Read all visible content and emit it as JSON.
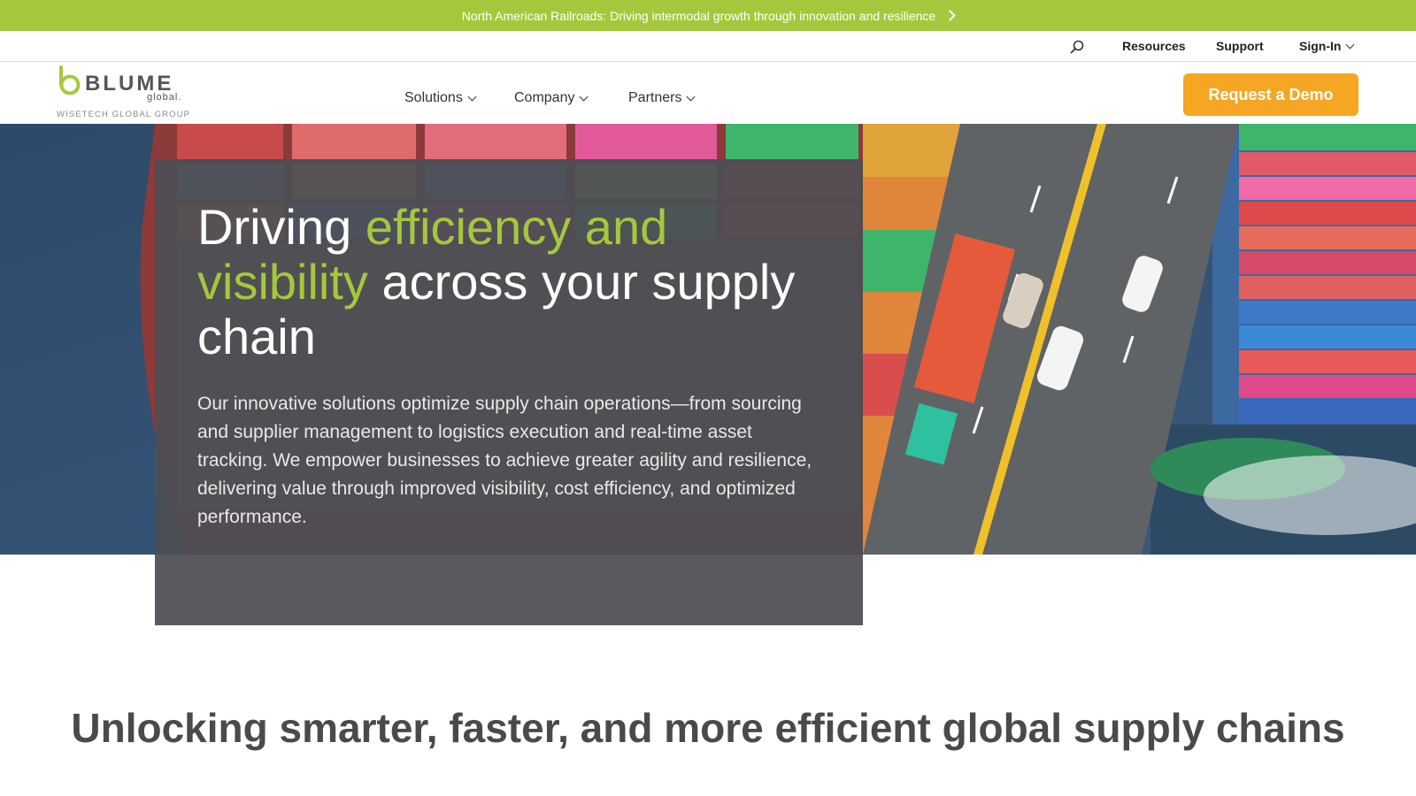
{
  "announcement": {
    "text": "North American Railroads: Driving intermodal growth through innovation and resilience"
  },
  "utility_nav": {
    "search_icon": "search-icon",
    "resources": "Resources",
    "support": "Support",
    "signin": "Sign-In"
  },
  "brand": {
    "name": "BLUME",
    "suffix": "global.",
    "tagline": "WISETECH GLOBAL GROUP"
  },
  "main_nav": {
    "items": [
      "Solutions",
      "Company",
      "Partners"
    ],
    "cta": "Request a Demo"
  },
  "hero": {
    "title_part1": "Driving ",
    "title_accent": "efficiency and visibility",
    "title_part2": " across your supply chain",
    "body": "Our innovative solutions optimize supply chain operations—from sourcing and supplier management to logistics execution and real-time asset tracking. We empower businesses to achieve greater agility and resilience, delivering value through improved visibility, cost efficiency, and optimized performance."
  },
  "section": {
    "title": "Unlocking smarter, faster, and more efficient global supply chains"
  },
  "colors": {
    "brand_green": "#a4c83c",
    "cta_orange": "#f5a623",
    "hero_card": "#4c4e54",
    "text_dark": "#4a4a4a"
  }
}
